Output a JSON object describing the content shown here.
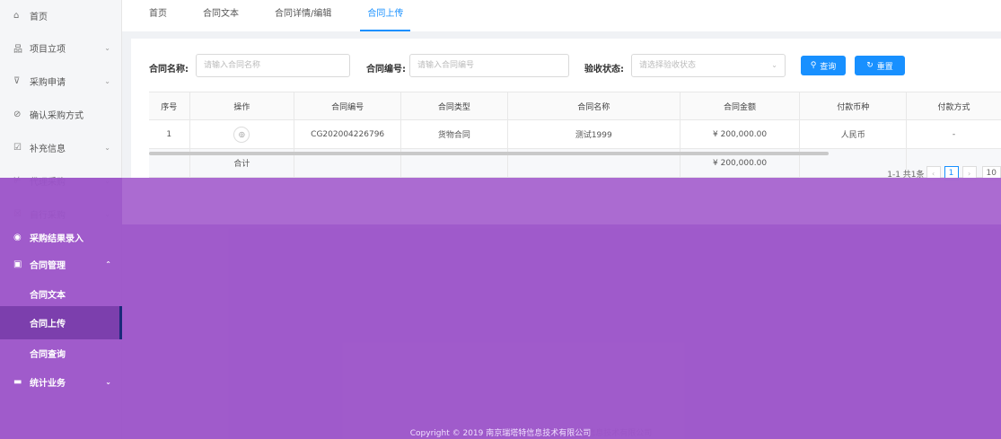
{
  "sidebar": {
    "items": [
      {
        "icon": "home-icon",
        "glyph": "⌂",
        "label": "首页",
        "chevron": ""
      },
      {
        "icon": "project-icon",
        "glyph": "品",
        "label": "项目立项",
        "chevron": "⌄"
      },
      {
        "icon": "cart-icon",
        "glyph": "⊽",
        "label": "采购申请",
        "chevron": "⌄"
      },
      {
        "icon": "check-circle-icon",
        "glyph": "⊘",
        "label": "确认采购方式",
        "chevron": ""
      },
      {
        "icon": "edit-icon",
        "glyph": "☑",
        "label": "补充信息",
        "chevron": "⌄"
      },
      {
        "icon": "agent-icon",
        "glyph": "⊬",
        "label": "代理采购",
        "chevron": "⌄"
      },
      {
        "icon": "self-icon",
        "glyph": "☒",
        "label": "自行采购",
        "chevron": "⌄"
      }
    ],
    "overlay_items": [
      {
        "icon": "result-icon",
        "glyph": "◉",
        "label": "采购结果录入",
        "chevron": ""
      },
      {
        "icon": "contract-icon",
        "glyph": "▣",
        "label": "合同管理",
        "chevron": "⌃"
      },
      {
        "icon": "",
        "glyph": "",
        "label": "合同文本",
        "chevron": ""
      },
      {
        "icon": "",
        "glyph": "",
        "label": "合同上传",
        "chevron": ""
      },
      {
        "icon": "",
        "glyph": "",
        "label": "合同查询",
        "chevron": ""
      },
      {
        "icon": "stats-icon",
        "glyph": "▬",
        "label": "统计业务",
        "chevron": "⌄"
      }
    ]
  },
  "tabs": [
    "首页",
    "合同文本",
    "合同详情/编辑",
    "合同上传"
  ],
  "filters": {
    "name_label": "合同名称:",
    "name_placeholder": "请输入合同名称",
    "code_label": "合同编号:",
    "code_placeholder": "请输入合同编号",
    "status_label": "验收状态:",
    "status_placeholder": "请选择验收状态",
    "search_label": "查询",
    "reset_label": "重置"
  },
  "table": {
    "headers": [
      "序号",
      "操作",
      "合同编号",
      "合同类型",
      "合同名称",
      "合同金额",
      "付款币种",
      "付款方式"
    ],
    "row": {
      "index": "1",
      "code": "CG202004226796",
      "type": "货物合同",
      "name": "测试1999",
      "amount": "¥ 200,000.00",
      "currency": "人民币",
      "payment": "-"
    },
    "total": {
      "label": "合计",
      "amount": "¥ 200,000.00"
    }
  },
  "pagination": {
    "summary": "1-1 共1条",
    "page": "1",
    "size": "10"
  },
  "footer": "Copyright © 2019 南京瑞塔特信息技术有限公司",
  "colors": {
    "accent": "#1890ff",
    "overlay": "#9c54c9"
  }
}
